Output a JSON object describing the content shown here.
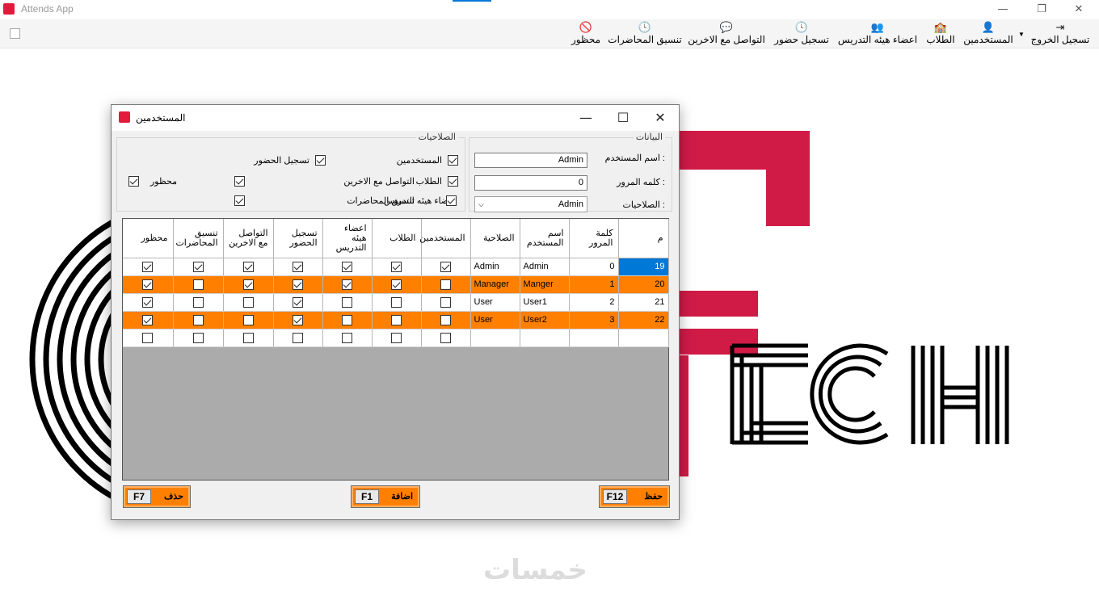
{
  "app": {
    "title": "Attends App",
    "colors": {
      "accent": "#0078d7",
      "orange": "#ff8000",
      "brand_red": "#e21b3c"
    }
  },
  "window_controls": {
    "minimize": "—",
    "restore": "❐",
    "close": "✕"
  },
  "menubar": {
    "items": [
      {
        "label": "تسجيل الخروج",
        "icon": "logout-icon",
        "glyph": "⇥"
      },
      {
        "label": "المستخدمين",
        "icon": "user-icon",
        "glyph": "👤"
      },
      {
        "label": "الطلاب",
        "icon": "students-icon",
        "glyph": "🏫"
      },
      {
        "label": "اعضاء هيئه التدريس",
        "icon": "group-icon",
        "glyph": "👥"
      },
      {
        "label": "تسجيل حضور",
        "icon": "clock-icon",
        "glyph": "🕓"
      },
      {
        "label": "التواصل مع الاخرين",
        "icon": "chat-icon",
        "glyph": "💬"
      },
      {
        "label": "تنسيق المحاضرات",
        "icon": "clock-icon",
        "glyph": "🕓"
      },
      {
        "label": "محظور",
        "icon": "blocked-icon",
        "glyph": "🚫"
      }
    ]
  },
  "background": {
    "logo_text": "ECH"
  },
  "dialog": {
    "title": "المستخدمين",
    "controls": {
      "minimize": "—",
      "maximize": "☐",
      "close": "✕"
    },
    "data_group": {
      "title": "البيانات",
      "username_label": "اسم المستخدم :",
      "username_value": "Admin",
      "password_label": "كلمه المرور :",
      "password_value": "0",
      "role_label": "الصلاحيات :",
      "role_value": "Admin"
    },
    "perm_group": {
      "title": "الصلاحيات",
      "items": [
        {
          "label": "المستخدمين",
          "checked": true
        },
        {
          "label": "الطلاب",
          "checked": true
        },
        {
          "label": "اعضاء هيئه التدريس",
          "checked": true
        },
        {
          "label": "تسجيل الحضور",
          "checked": true
        },
        {
          "label": "التواصل مع الاخرين",
          "checked": true
        },
        {
          "label": "تنسيق المحاضرات",
          "checked": true
        },
        {
          "label": "محظور",
          "checked": true
        }
      ]
    },
    "grid": {
      "columns": [
        "م",
        "كلمة المرور",
        "اسم المستخدم",
        "الصلاحية",
        "المستخدمين",
        "الطلاب",
        "اعضاء هيئه التدريس",
        "تسجيل الحضور",
        "التواصل مع الاخرين",
        "تنسيق المحاضرات",
        "محظور"
      ],
      "rows": [
        {
          "id": "19",
          "password": "0",
          "username": "Admin",
          "role": "Admin",
          "checks": [
            true,
            true,
            true,
            true,
            true,
            true,
            true
          ],
          "style": "white",
          "selected": true
        },
        {
          "id": "20",
          "password": "1",
          "username": "Manger",
          "role": "Manager",
          "checks": [
            false,
            true,
            true,
            true,
            true,
            false,
            true
          ],
          "style": "orange",
          "selected": false
        },
        {
          "id": "21",
          "password": "2",
          "username": "User1",
          "role": "User",
          "checks": [
            false,
            false,
            false,
            true,
            false,
            false,
            true
          ],
          "style": "white",
          "selected": false
        },
        {
          "id": "22",
          "password": "3",
          "username": "User2",
          "role": "User",
          "checks": [
            false,
            false,
            false,
            true,
            false,
            false,
            true
          ],
          "style": "orange",
          "selected": false
        },
        {
          "id": "",
          "password": "",
          "username": "",
          "role": "",
          "checks": [
            false,
            false,
            false,
            false,
            false,
            false,
            false
          ],
          "style": "white",
          "selected": false
        }
      ]
    },
    "buttons": {
      "save": {
        "label": "حفظ",
        "key": "F12"
      },
      "add": {
        "label": "اضافة",
        "key": "F1"
      },
      "delete": {
        "label": "حذف",
        "key": "F7"
      }
    }
  },
  "watermark": "خمسات"
}
